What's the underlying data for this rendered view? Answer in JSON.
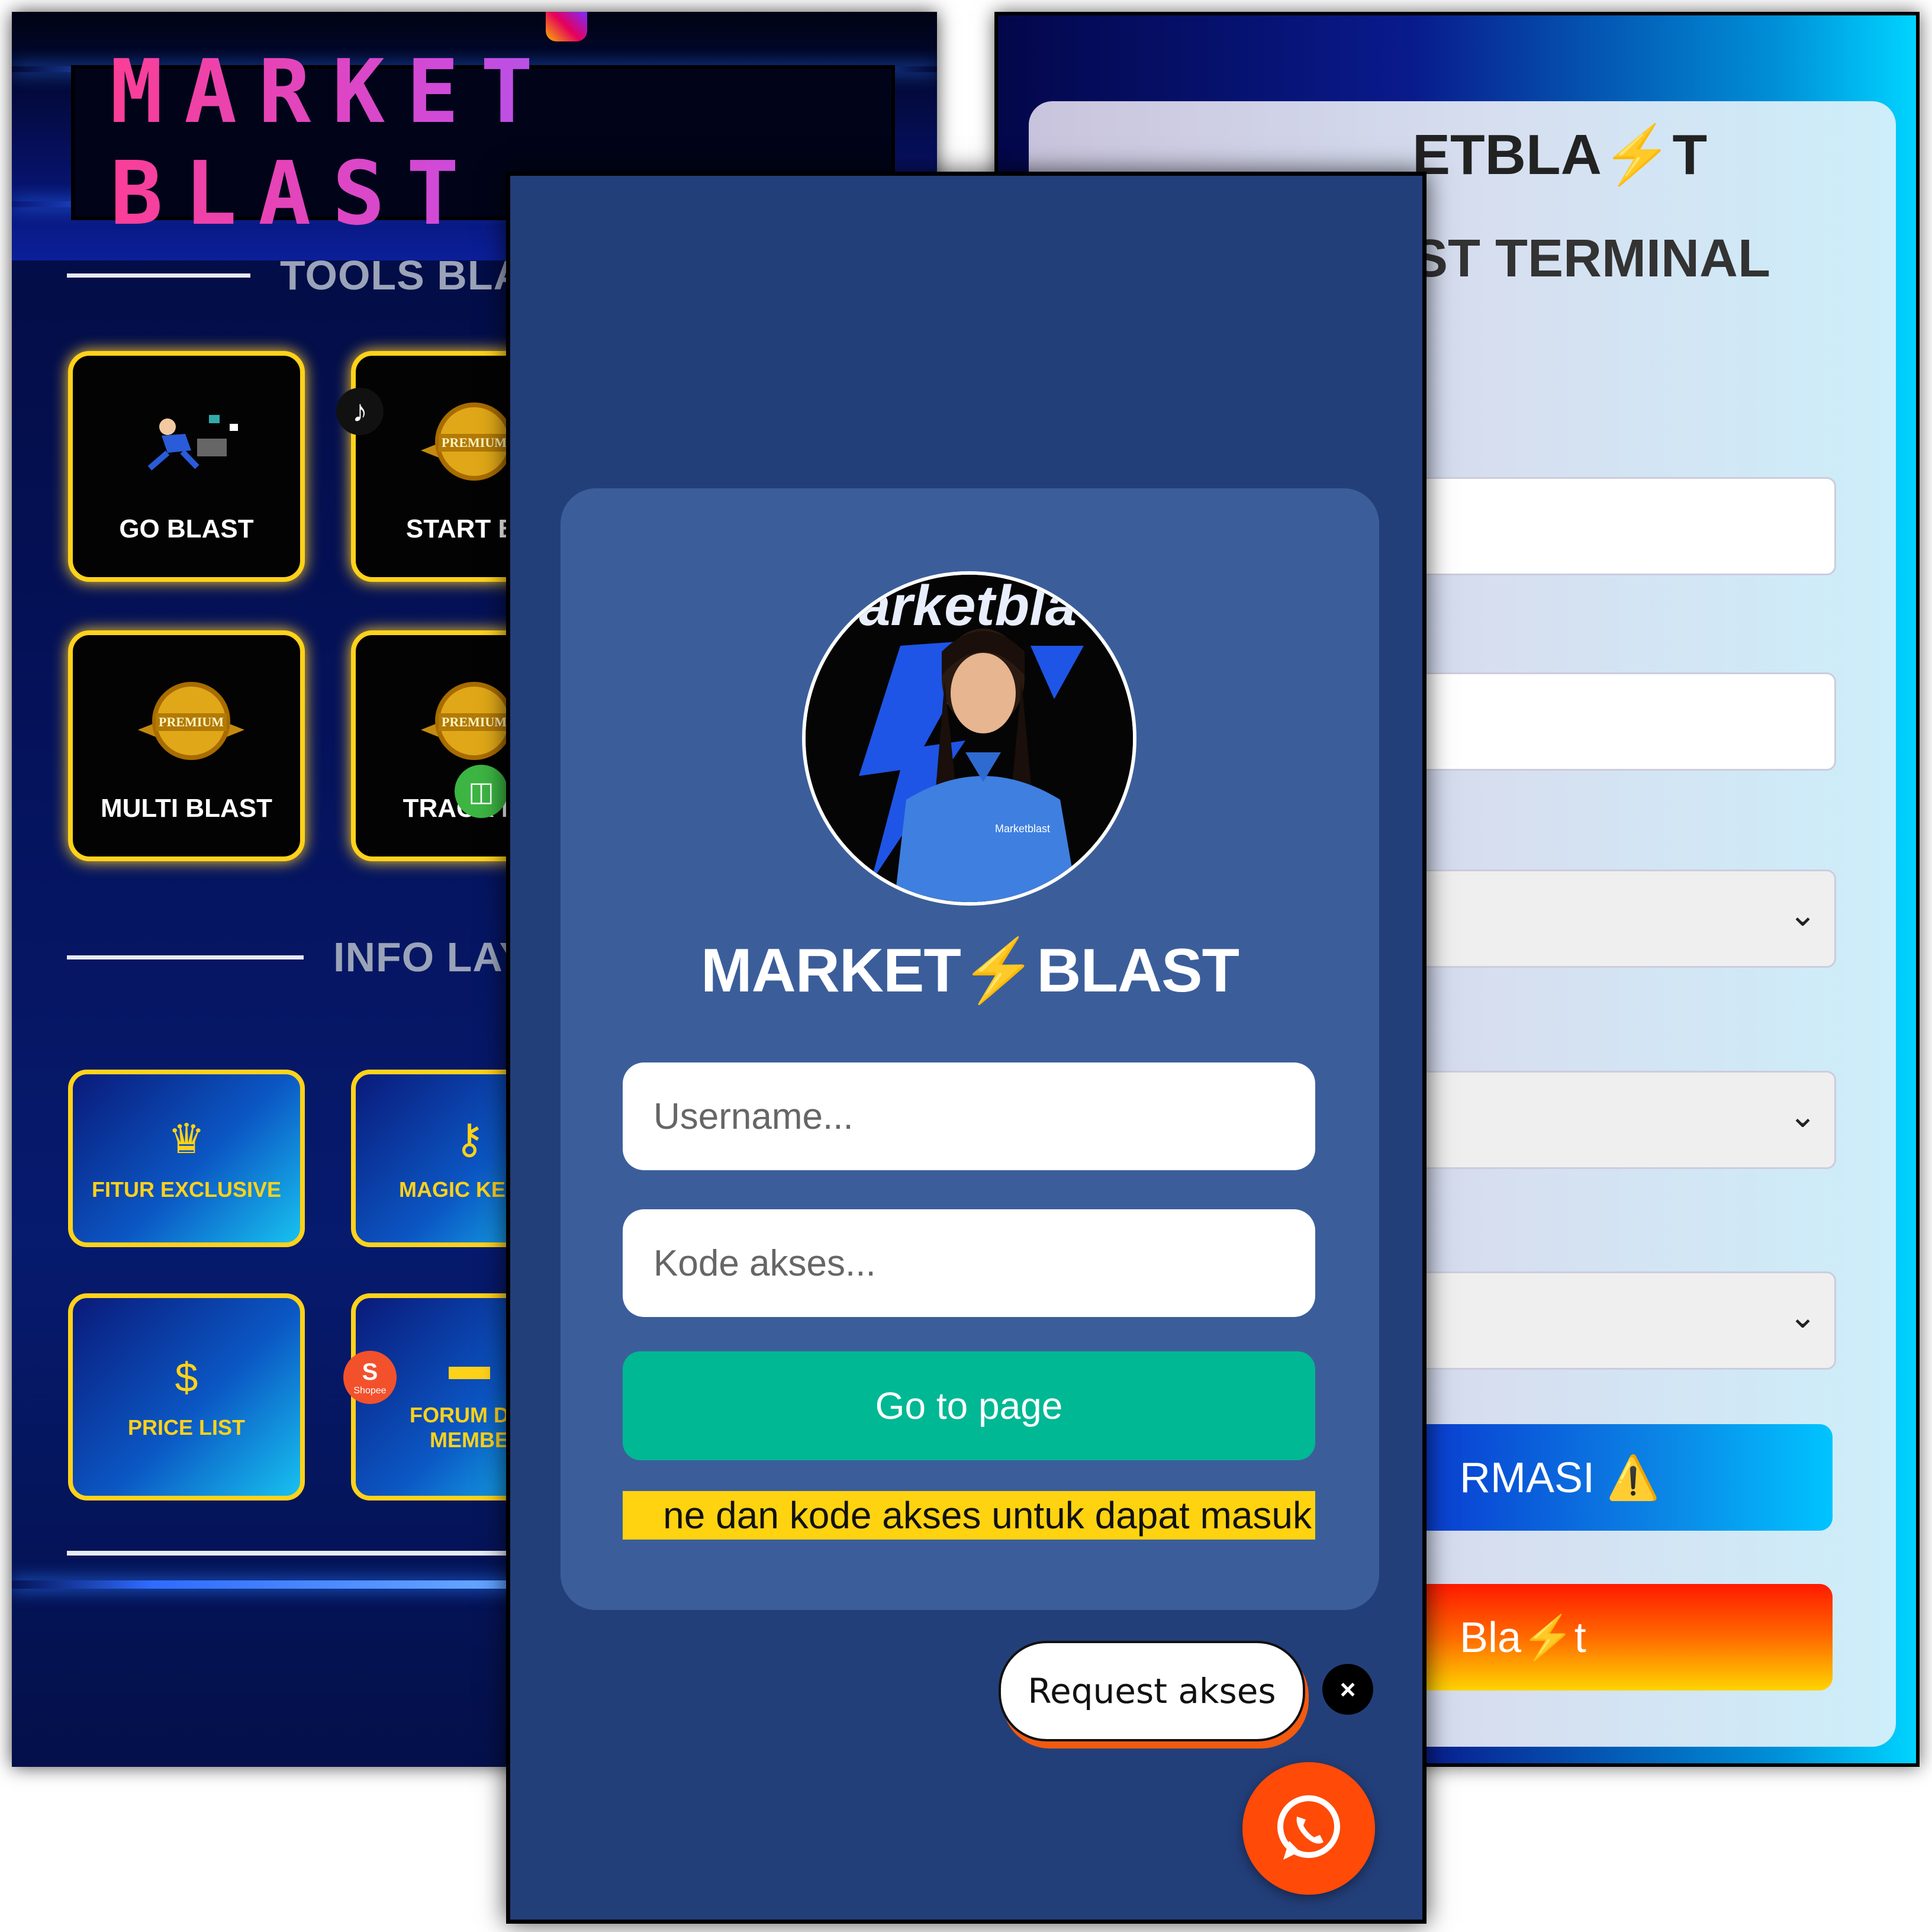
{
  "left_screen": {
    "brand_title": "MARKET  BLAST",
    "section_tools": "TOOLS BLAS",
    "section_info": "INFO LAY",
    "tools": [
      {
        "label": "GO BLAST",
        "icon": "runner-icon"
      },
      {
        "label": "START BL",
        "icon": "premium-medal-icon"
      },
      {
        "label": "MULTI BLAST",
        "icon": "premium-medal-icon"
      },
      {
        "label": "TRACK BL",
        "icon": "premium-medal-icon"
      }
    ],
    "medal_text": "PREMIUM",
    "info_tiles": [
      {
        "label": "FITUR EXCLUSIVE",
        "icon": "crown-icon"
      },
      {
        "label": "MAGIC KEYW",
        "icon": "key-icon"
      },
      {
        "label": "PRICE LIST",
        "icon": "price-hand-icon"
      },
      {
        "label": "FORUM DIS",
        "label2": "MEMBE",
        "icon": "chat-icon"
      }
    ],
    "shopee_text": "Shopee"
  },
  "center_screen": {
    "avatar_text": "arketbla",
    "shirt_text": "Marketblast",
    "title_left": "MARKET",
    "title_bolt": "⚡",
    "title_right": "BLAST",
    "username_placeholder": "Username...",
    "code_placeholder": "Kode akses...",
    "go_button": "Go to page",
    "marquee_text": "ne dan kode akses untuk dapat masuk",
    "request_button": "Request akses",
    "close_glyph": "×"
  },
  "right_screen": {
    "heading1": "ETBLA⚡T",
    "heading2": "ST TERMINAL",
    "select_chevron": "⌄",
    "button_info": "RMASI ⚠️",
    "button_gradient": "Bla⚡t"
  },
  "colors": {
    "tile_border": "#ffd21a",
    "go_button": "#00b894",
    "marquee_bg": "#ffd310",
    "whatsapp_button": "#ff4a08",
    "center_bg": "#233f7a",
    "login_card": "#3b5e9b"
  }
}
